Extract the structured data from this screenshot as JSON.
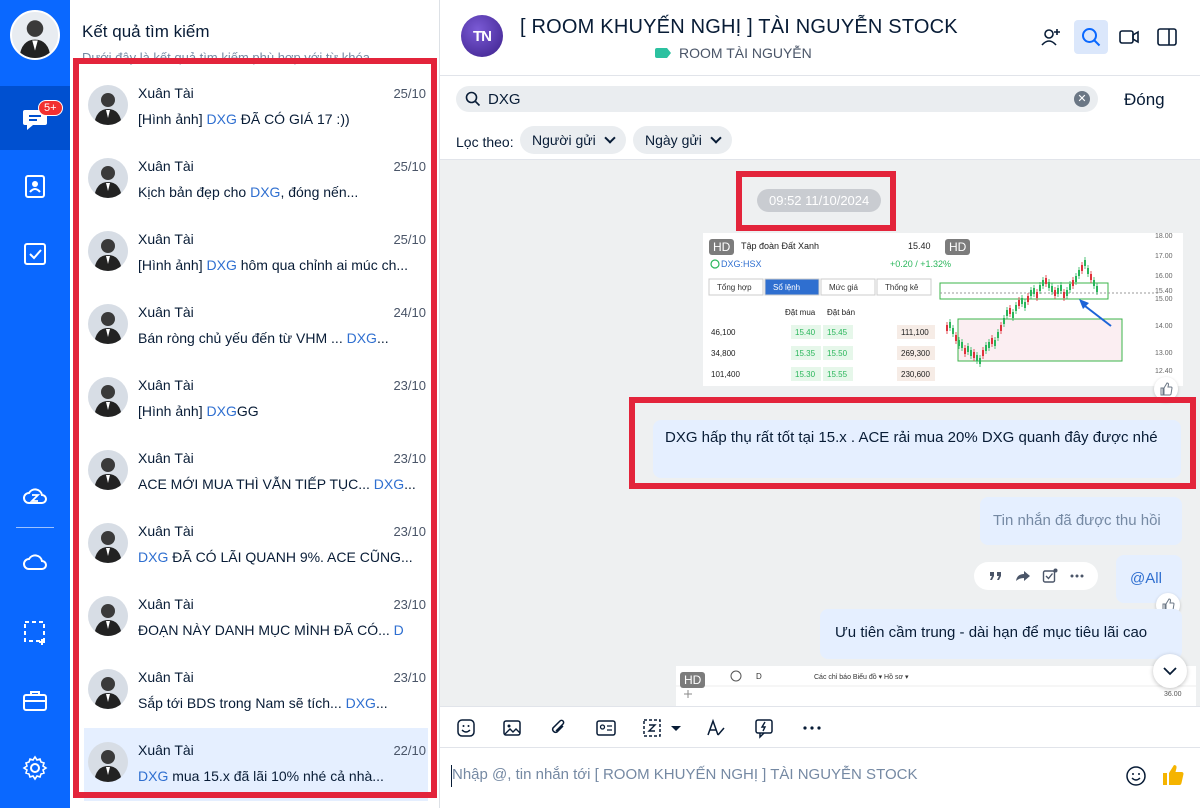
{
  "app": {
    "nav_badge": "5+"
  },
  "results_panel": {
    "title": "Kết quả tìm kiếm",
    "subtitle": "Dưới đây là kết quả tìm kiếm phù hợp với từ khóa",
    "items": [
      {
        "name": "Xuân Tài",
        "date": "25/10",
        "prefix": "[Hình ảnh] ",
        "hl": "DXG",
        "suffix": " ĐÃ CÓ GIÁ 17 :))"
      },
      {
        "name": "Xuân Tài",
        "date": "25/10",
        "prefix": "Kịch bản đẹp cho ",
        "hl": "DXG",
        "suffix": ", đóng nến..."
      },
      {
        "name": "Xuân Tài",
        "date": "25/10",
        "prefix": "[Hình ảnh] ",
        "hl": "DXG",
        "suffix": " hôm qua chỉnh ai múc ch..."
      },
      {
        "name": "Xuân Tài",
        "date": "24/10",
        "prefix": "Bán ròng chủ yếu đến từ VHM ... ",
        "hl": "DXG",
        "suffix": "..."
      },
      {
        "name": "Xuân Tài",
        "date": "23/10",
        "prefix": "[Hình ảnh] ",
        "hl": "DXG",
        "suffix": "GG"
      },
      {
        "name": "Xuân Tài",
        "date": "23/10",
        "prefix": "ACE MỚI MUA THÌ VẪN TIẾP TỤC... ",
        "hl": "DXG",
        "suffix": "..."
      },
      {
        "name": "Xuân Tài",
        "date": "23/10",
        "prefix": "",
        "hl": "DXG",
        "suffix": " ĐÃ CÓ LÃI QUANH 9%. ACE CŨNG..."
      },
      {
        "name": "Xuân Tài",
        "date": "23/10",
        "prefix": "ĐOẠN NÀY DANH MỤC MÌNH ĐÃ CÓ... ",
        "hl": "D",
        "suffix": ""
      },
      {
        "name": "Xuân Tài",
        "date": "23/10",
        "prefix": "Sắp tới BDS trong Nam sẽ tích... ",
        "hl": "DXG",
        "suffix": "..."
      },
      {
        "name": "Xuân Tài",
        "date": "22/10",
        "prefix": "",
        "hl": "DXG",
        "suffix": " mua 15.x đã lãi 10% nhé cả nhà..."
      }
    ]
  },
  "chat": {
    "avatar_text": "TN",
    "title": "[ ROOM KHUYẾN NGHỊ ] TÀI NGUYỄN STOCK",
    "subtitle": "ROOM TÀI NGUYỄN",
    "search": {
      "value": "DXG",
      "close_label": "Đóng",
      "filter_label": "Lọc theo:",
      "filter_sender": "Người gửi",
      "filter_date": "Ngày gửi"
    },
    "timestamp": "09:52 11/10/2024",
    "image1": {
      "hd": "HD",
      "company": "Tập đoàn Đất Xanh",
      "ticker": "DXG:HSX",
      "price": "15.40",
      "change": "+0.20 / +1.32%",
      "tabs": [
        "Tổng hợp",
        "Sổ lệnh",
        "Mức giá",
        "Thống kê"
      ],
      "col_buy": "Đặt mua",
      "col_sell": "Đặt bán",
      "rows": [
        {
          "vol": "46,100",
          "buy": "15.40",
          "sell": "15.45",
          "svol": "111,100"
        },
        {
          "vol": "34,800",
          "buy": "15.35",
          "sell": "15.50",
          "svol": "269,300"
        },
        {
          "vol": "101,400",
          "buy": "15.30",
          "sell": "15.55",
          "svol": "230,600"
        }
      ],
      "axis": [
        "18.00",
        "17.00",
        "16.00",
        "15.40",
        "15.00",
        "14.00",
        "13.00",
        "12.40"
      ]
    },
    "messages": {
      "main": "DXG hấp thụ rất tốt tại 15.x . ACE rải mua 20% DXG quanh đây được nhé",
      "recalled": "Tin nhắn đã được thu hồi",
      "mention": "@All",
      "priority": "Ưu tiên cầm trung - dài hạn để mục tiêu lãi cao"
    },
    "image2": {
      "hd": "HD",
      "toolbar_text": "Các chỉ báo   Biểu đồ ▾   Hồ sơ ▾",
      "interval": "D",
      "axis_value": "36.00"
    },
    "composer_placeholder": "Nhập @, tin nhắn tới [ ROOM KHUYẾN NGHỊ ] TÀI NGUYỄN STOCK"
  },
  "colors": {
    "rail": "#0a68ff",
    "highlight": "#2f6fd0",
    "annotation_red": "#e3243b",
    "bubble": "#e5efff"
  },
  "icons": [
    "chat-icon",
    "contacts-icon",
    "todo-icon",
    "zcloud-icon",
    "cloud-icon",
    "screenshot-icon",
    "briefcase-icon",
    "settings-icon",
    "add-member-icon",
    "search-icon",
    "video-call-icon",
    "sidebar-toggle-icon"
  ]
}
